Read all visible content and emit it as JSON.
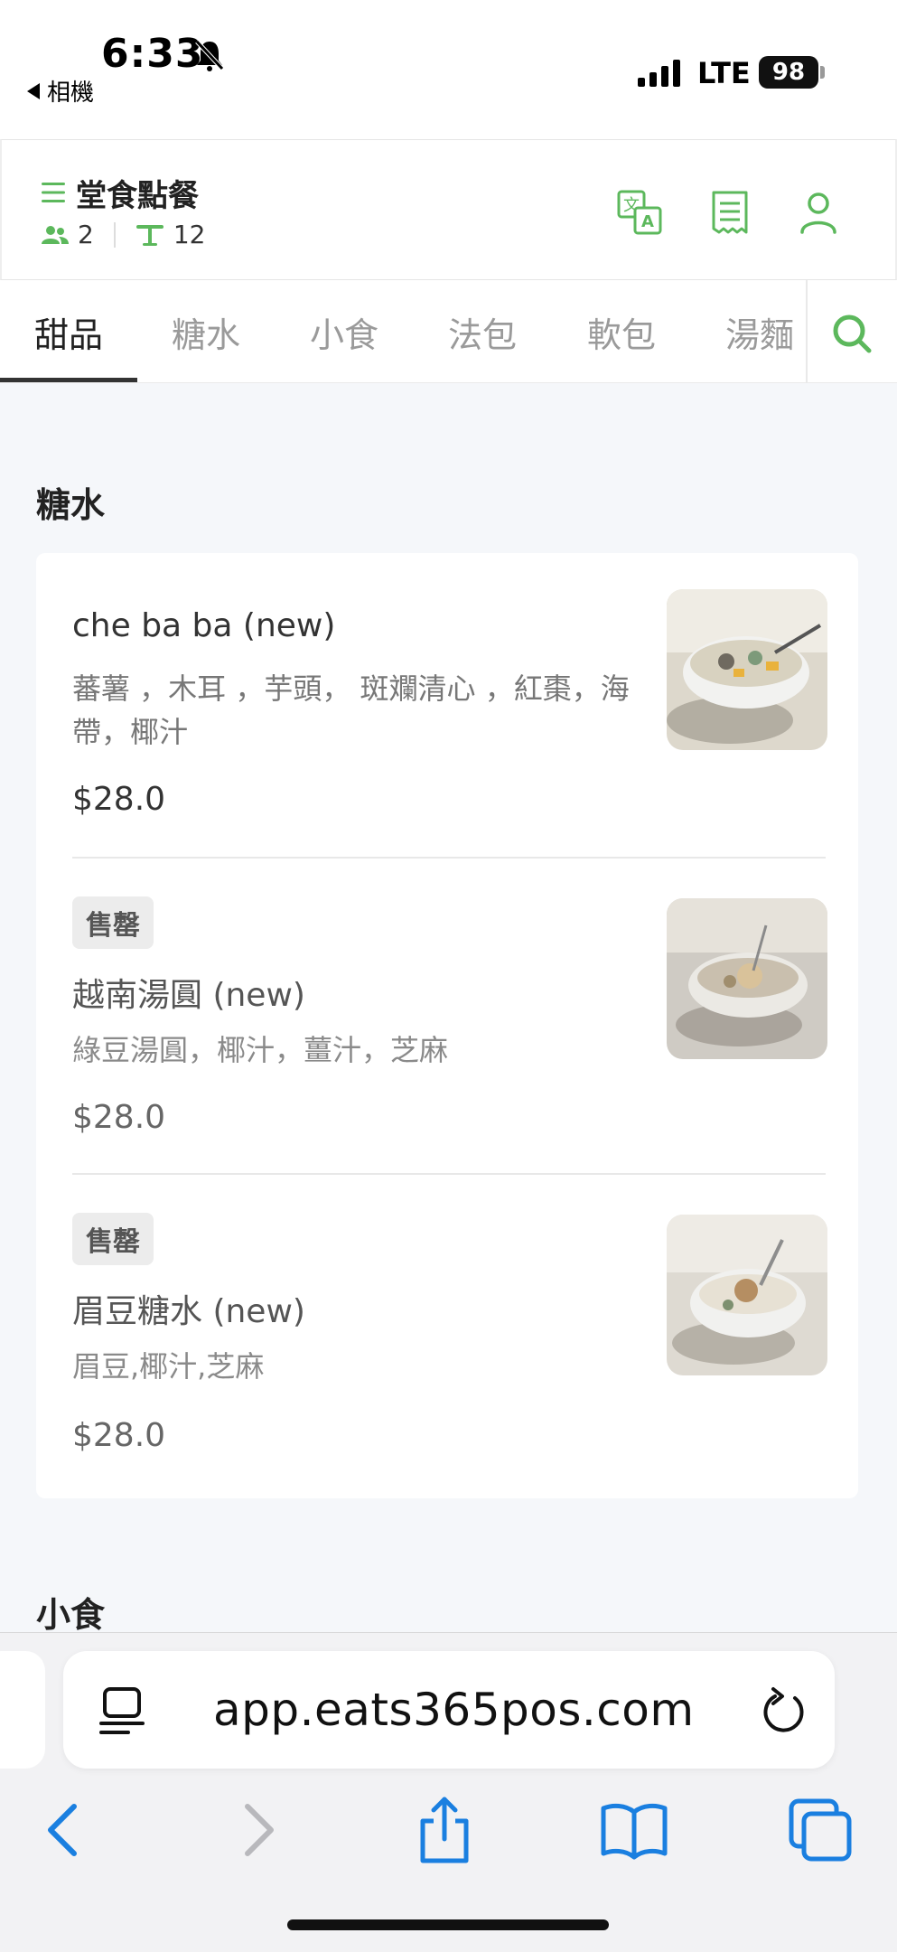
{
  "status_bar": {
    "time": "6:33",
    "back_app": "相機",
    "network": "LTE",
    "battery": "98"
  },
  "header": {
    "title": "堂食點餐",
    "guests": "2",
    "table": "12",
    "accent_color": "#5cb85c"
  },
  "tabs": [
    "甜品",
    "糖水",
    "小食",
    "法包",
    "軟包",
    "湯麵"
  ],
  "active_tab": "甜品",
  "sections": [
    {
      "title": "糖水",
      "items": [
        {
          "name": "che ba ba (new)",
          "description": "蕃薯 ，木耳 ，芋頭， 斑斕清心 ，紅棗，海帶，椰汁",
          "price": "$28.0",
          "badge": ""
        },
        {
          "name": "越南湯圓 (new)",
          "description": "綠豆湯圓，椰汁，薑汁，芝麻",
          "price": "$28.0",
          "badge": "售罄"
        },
        {
          "name": "眉豆糖水 (new)",
          "description": "眉豆,椰汁,芝麻",
          "price": "$28.0",
          "badge": "售罄"
        }
      ]
    },
    {
      "title": "小食",
      "items": []
    }
  ],
  "browser": {
    "url": "app.eats365pos.com",
    "tint_color": "#1a7fe0"
  }
}
